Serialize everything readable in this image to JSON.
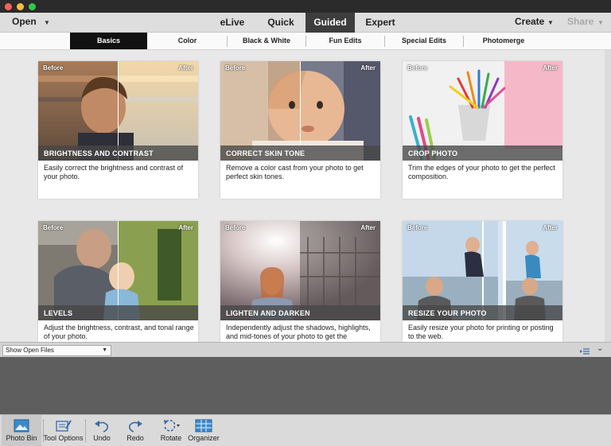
{
  "menu": {
    "open": "Open",
    "create": "Create",
    "share": "Share"
  },
  "modes": [
    "eLive",
    "Quick",
    "Guided",
    "Expert"
  ],
  "guided_tabs": [
    "Basics",
    "Color",
    "Black & White",
    "Fun Edits",
    "Special Edits",
    "Photomerge"
  ],
  "cards": [
    {
      "before": "Before",
      "after": "After",
      "title": "BRIGHTNESS AND CONTRAST",
      "desc": "Easily correct the brightness and contrast of your photo."
    },
    {
      "before": "Before",
      "after": "After",
      "title": "CORRECT SKIN TONE",
      "desc": "Remove a color cast from your photo to get perfect skin tones."
    },
    {
      "before": "Before",
      "after": "After",
      "title": "CROP PHOTO",
      "desc": "Trim the edges of your photo to get the perfect composition."
    },
    {
      "before": "Before",
      "after": "After",
      "title": "LEVELS",
      "desc": "Adjust the brightness, contrast, and tonal range of your photo."
    },
    {
      "before": "Before",
      "after": "After",
      "title": "LIGHTEN AND DARKEN",
      "desc": "Independently adjust the shadows, highlights, and mid-tones of your photo to get the"
    },
    {
      "before": "Before",
      "after": "After",
      "title": "RESIZE YOUR PHOTO",
      "desc": "Easily resize your photo for printing or posting to the web."
    }
  ],
  "panel": {
    "dropdown": "Show Open Files"
  },
  "tools": [
    "Photo Bin",
    "Tool Options",
    "Undo",
    "Redo",
    "Rotate",
    "Organizer"
  ],
  "colors": {
    "accent_tab": "#111111",
    "mode_active": "#3d3d3d",
    "card_title_bg": "#464646"
  }
}
